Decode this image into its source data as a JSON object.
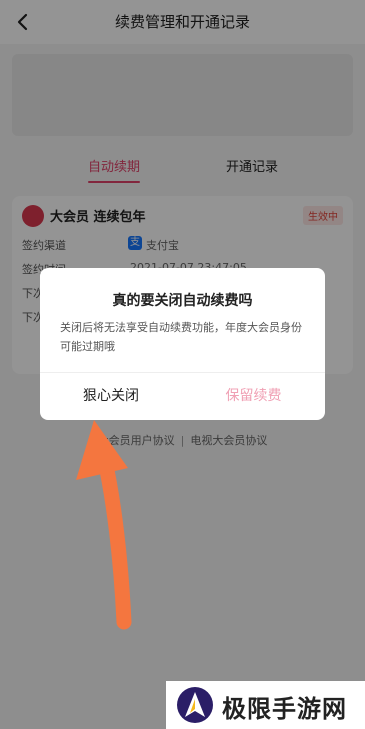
{
  "header": {
    "title": "续费管理和开通记录"
  },
  "tabs": [
    {
      "label": "自动续期"
    },
    {
      "label": "开通记录"
    }
  ],
  "card": {
    "title": "大会员 连续包年",
    "status": "生效中",
    "rows": [
      {
        "label": "签约渠道",
        "value": "支付宝"
      },
      {
        "label": "签约时间",
        "value": "2021-07-07 23:47:05"
      },
      {
        "label": "下次",
        "value": ""
      },
      {
        "label": "下次",
        "value": ""
      }
    ]
  },
  "agreements": {
    "left": "大会员用户协议",
    "right": "电视大会员协议"
  },
  "dialog": {
    "title": "真的要关闭自动续费吗",
    "message": "关闭后将无法享受自动续费功能，年度大会员身份可能过期哦",
    "close_label": "狠心关闭",
    "keep_label": "保留续费"
  },
  "watermark": {
    "text": "极限手游网"
  },
  "colors": {
    "accent": "#e0436a",
    "keep_button": "#f0a0b4",
    "arrow": "#f4763f",
    "status": "#e2453c"
  }
}
